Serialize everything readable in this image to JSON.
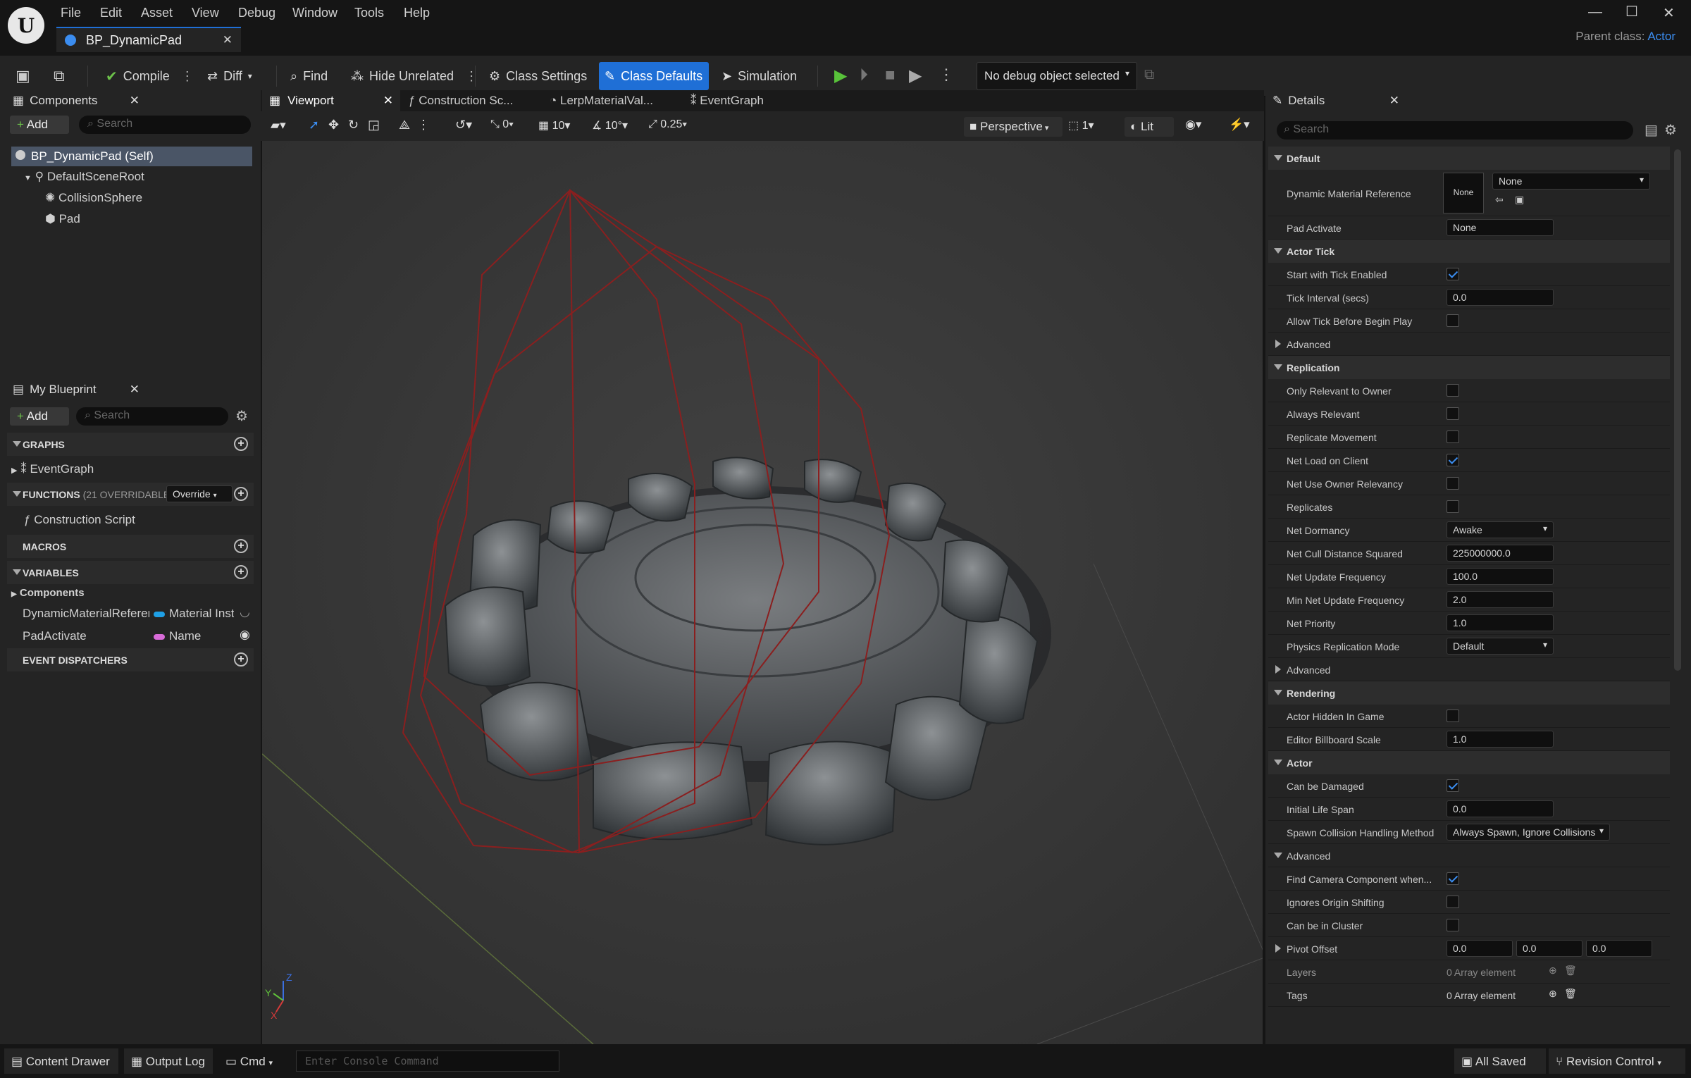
{
  "menu": [
    "File",
    "Edit",
    "Asset",
    "View",
    "Debug",
    "Window",
    "Tools",
    "Help"
  ],
  "doc_tab": {
    "title": "BP_DynamicPad"
  },
  "parent_class": {
    "label": "Parent class:",
    "value": "Actor"
  },
  "toolbar": {
    "compile": "Compile",
    "diff": "Diff",
    "find": "Find",
    "hide_unrelated": "Hide Unrelated",
    "class_settings": "Class Settings",
    "class_defaults": "Class Defaults",
    "simulation": "Simulation",
    "debug_object": "No debug object selected"
  },
  "components": {
    "tab": "Components",
    "add": "Add",
    "search_placeholder": "Search",
    "tree": [
      {
        "label": "BP_DynamicPad (Self)"
      },
      {
        "label": "DefaultSceneRoot"
      },
      {
        "label": "CollisionSphere"
      },
      {
        "label": "Pad"
      }
    ]
  },
  "my_blueprint": {
    "tab": "My Blueprint",
    "add": "Add",
    "search_placeholder": "Search",
    "graphs": "GRAPHS",
    "event_graph": "EventGraph",
    "functions": "FUNCTIONS",
    "functions_count": "(21 OVERRIDABLE)",
    "override": "Override",
    "construction_script": "Construction Script",
    "macros": "MACROS",
    "variables": "VARIABLES",
    "components_group": "Components",
    "vars": [
      {
        "name": "DynamicMaterialReferer",
        "type": "Material Inst",
        "color": "#1fa0e6"
      },
      {
        "name": "PadActivate",
        "type": "Name",
        "color": "#d86bd8"
      }
    ],
    "event_dispatchers": "EVENT DISPATCHERS"
  },
  "graph_tabs": [
    "Viewport",
    "Construction Sc...",
    "LerpMaterialVal...",
    "EventGraph"
  ],
  "viewport": {
    "perspective": "Perspective",
    "lit": "Lit",
    "grid": "10",
    "rot": "10°",
    "scale": "0.25",
    "snap0": "0",
    "cam": "1"
  },
  "details": {
    "tab": "Details",
    "search_placeholder": "Search",
    "default_cat": "Default",
    "dmr_label": "Dynamic Material Reference",
    "dmr_thumb": "None",
    "dmr_value": "None",
    "pad_activate_label": "Pad Activate",
    "pad_activate_value": "None",
    "actor_tick": "Actor Tick",
    "start_tick": "Start with Tick Enabled",
    "tick_interval": "Tick Interval (secs)",
    "tick_interval_value": "0.0",
    "allow_tick": "Allow Tick Before Begin Play",
    "advanced": "Advanced",
    "replication": "Replication",
    "only_relevant": "Only Relevant to Owner",
    "always_relevant": "Always Relevant",
    "replicate_movement": "Replicate Movement",
    "net_load": "Net Load on Client",
    "net_owner_rel": "Net Use Owner Relevancy",
    "replicates": "Replicates",
    "net_dormancy": "Net Dormancy",
    "net_dormancy_value": "Awake",
    "net_cull": "Net Cull Distance Squared",
    "net_cull_value": "225000000.0",
    "net_update": "Net Update Frequency",
    "net_update_value": "100.0",
    "min_net_update": "Min Net Update Frequency",
    "min_net_update_value": "2.0",
    "net_priority": "Net Priority",
    "net_priority_value": "1.0",
    "phys_rep": "Physics Replication Mode",
    "phys_rep_value": "Default",
    "rendering": "Rendering",
    "hidden_in_game": "Actor Hidden In Game",
    "billboard": "Editor Billboard Scale",
    "billboard_value": "1.0",
    "actor": "Actor",
    "can_damage": "Can be Damaged",
    "life_span": "Initial Life Span",
    "life_span_value": "0.0",
    "spawn_coll": "Spawn Collision Handling Method",
    "spawn_coll_value": "Always Spawn, Ignore Collisions",
    "find_camera": "Find Camera Component when...",
    "ignores_origin": "Ignores Origin Shifting",
    "can_cluster": "Can be in Cluster",
    "pivot": "Pivot Offset",
    "pivot_x": "0.0",
    "pivot_y": "0.0",
    "pivot_z": "0.0",
    "layers": "Layers",
    "layers_value": "0 Array element",
    "tags": "Tags",
    "tags_value": "0 Array element"
  },
  "statusbar": {
    "content_drawer": "Content Drawer",
    "output_log": "Output Log",
    "cmd": "Cmd",
    "console_placeholder": "Enter Console Command",
    "all_saved": "All Saved",
    "revision": "Revision Control"
  }
}
